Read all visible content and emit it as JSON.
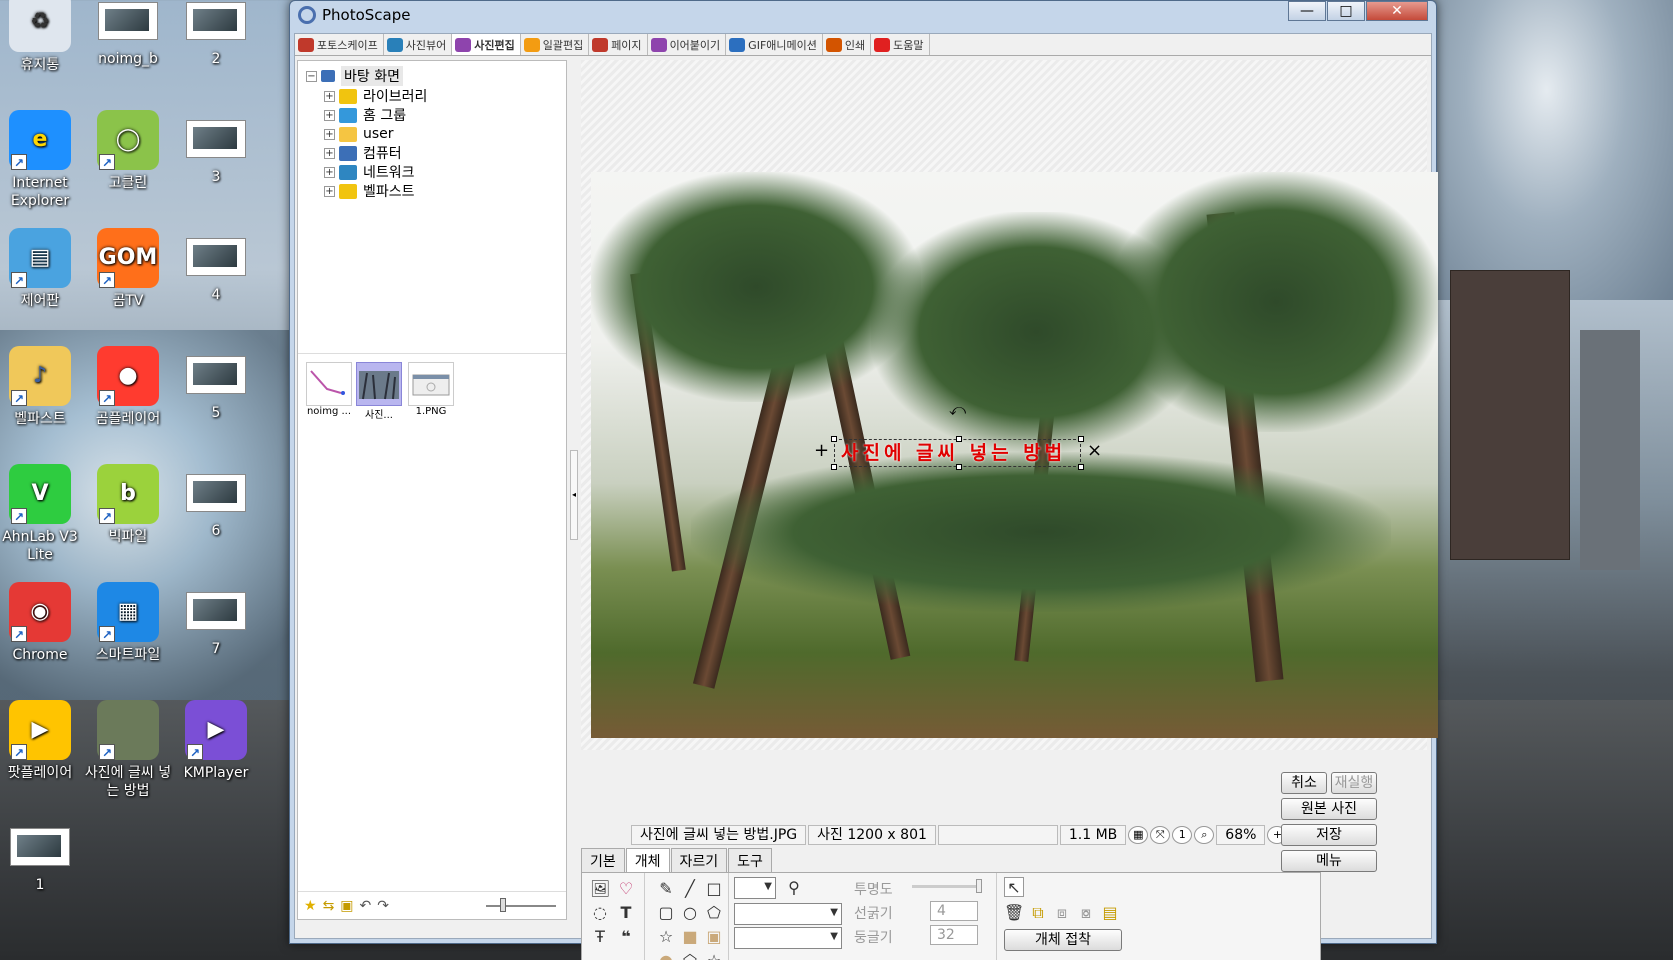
{
  "desktop": {
    "icons": [
      {
        "label": "휴지통",
        "kind": "recycle"
      },
      {
        "label": "noimg_b",
        "kind": "thumb"
      },
      {
        "label": "2",
        "kind": "thumb"
      },
      {
        "label": "Internet Explorer",
        "kind": "ie"
      },
      {
        "label": "고클린",
        "kind": "goclean"
      },
      {
        "label": "3",
        "kind": "thumb"
      },
      {
        "label": "제어판",
        "kind": "control"
      },
      {
        "label": "곰TV",
        "kind": "gomtv"
      },
      {
        "label": "4",
        "kind": "thumb"
      },
      {
        "label": "벨파스트",
        "kind": "folder"
      },
      {
        "label": "곰플레이어",
        "kind": "gomplayer"
      },
      {
        "label": "5",
        "kind": "thumb"
      },
      {
        "label": "AhnLab V3 Lite",
        "kind": "v3"
      },
      {
        "label": "빅파일",
        "kind": "bigfile"
      },
      {
        "label": "6",
        "kind": "thumb"
      },
      {
        "label": "Chrome",
        "kind": "chrome"
      },
      {
        "label": "스마트파일",
        "kind": "smartfile"
      },
      {
        "label": "7",
        "kind": "thumb"
      },
      {
        "label": "팟플레이어",
        "kind": "potplayer"
      },
      {
        "label": "사진에 글씨 넣는 방법",
        "kind": "photo"
      },
      {
        "label": "KMPlayer",
        "kind": "kmplayer"
      },
      {
        "label": "1",
        "kind": "thumb"
      }
    ]
  },
  "window": {
    "title": "PhotoScape",
    "controls": {
      "minimize": "—",
      "maximize": "□",
      "close": "✕"
    }
  },
  "tabs": [
    {
      "label": "포토스케이프",
      "color": "#c0392b"
    },
    {
      "label": "사진뷰어",
      "color": "#2980b9"
    },
    {
      "label": "사진편집",
      "color": "#8e44ad"
    },
    {
      "label": "일괄편집",
      "color": "#f39c12"
    },
    {
      "label": "페이지",
      "color": "#c0392b"
    },
    {
      "label": "이어붙이기",
      "color": "#8e44ad"
    },
    {
      "label": "GIF애니메이션",
      "color": "#2c6fbf"
    },
    {
      "label": "인쇄",
      "color": "#d35400"
    },
    {
      "label": "도움말",
      "color": "#e02020"
    }
  ],
  "tree": {
    "root": "바탕 화면",
    "children": [
      {
        "label": "라이브러리",
        "color": "#f1c40f"
      },
      {
        "label": "홈 그룹",
        "color": "#3498db"
      },
      {
        "label": "user",
        "color": "#f5c542"
      },
      {
        "label": "컴퓨터",
        "color": "#3c6fb7"
      },
      {
        "label": "네트워크",
        "color": "#2e86c1"
      },
      {
        "label": "벨파스트",
        "color": "#f1c40f"
      }
    ]
  },
  "thumbnails": [
    {
      "label": "noimg ...",
      "selected": false
    },
    {
      "label": "사진...",
      "selected": true
    },
    {
      "label": "1.PNG",
      "selected": false
    }
  ],
  "photo": {
    "text_object": "사진에 글씨 넣는 방법"
  },
  "status": {
    "filename": "사진에 글씨 넣는 방법.JPG",
    "dimensions": "사진 1200 x 801",
    "filesize": "1.1 MB",
    "zoom": "68%"
  },
  "edit_tabs": [
    "기본",
    "개체",
    "자르기",
    "도구"
  ],
  "edit_panel": {
    "opacity_label": "투명도",
    "line_label": "선굵기",
    "line_value": "4",
    "round_label": "둥글기",
    "round_value": "32",
    "attach_button": "개체 접착"
  },
  "side_buttons": {
    "cancel": "취소",
    "redo": "재실행",
    "original": "원본 사진",
    "save": "저장",
    "menu": "메뉴"
  }
}
